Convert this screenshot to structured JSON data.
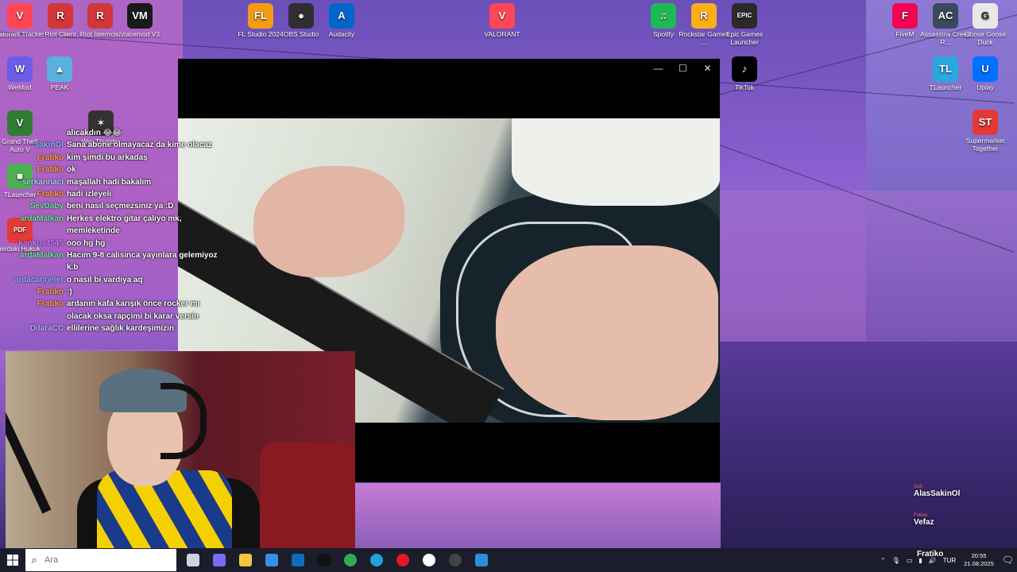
{
  "desktop": {
    "icons": [
      {
        "id": "valorant-tracker",
        "label": "Valorant Tracker",
        "color": "#ff4655",
        "glyph": "V"
      },
      {
        "id": "riot-client",
        "label": "Riot Client",
        "color": "#d13639",
        "glyph": "R"
      },
      {
        "id": "riot-istemcisi",
        "label": "Riot İstemcisi",
        "color": "#d13639",
        "glyph": "R"
      },
      {
        "id": "voicemod",
        "label": "Voicemod V3",
        "color": "#1a1a1a",
        "glyph": "VM"
      },
      {
        "id": "fl-studio",
        "label": "FL Studio 2024",
        "color": "#f39c12",
        "glyph": "FL"
      },
      {
        "id": "obs-studio",
        "label": "OBS Studio",
        "color": "#302e31",
        "glyph": "●"
      },
      {
        "id": "audacity",
        "label": "Audacity",
        "color": "#0066cc",
        "glyph": "A"
      },
      {
        "id": "valorant",
        "label": "VALORANT",
        "color": "#ff4655",
        "glyph": "V"
      },
      {
        "id": "spotify",
        "label": "Spotify",
        "color": "#1db954",
        "glyph": "♫"
      },
      {
        "id": "rockstar",
        "label": "Rockstar Games ...",
        "color": "#fcaf17",
        "glyph": "R"
      },
      {
        "id": "epic-games",
        "label": "Epic Games Launcher",
        "color": "#2a2a2a",
        "glyph": "EPIC"
      },
      {
        "id": "fivem",
        "label": "FiveM",
        "color": "#f40552",
        "glyph": "F"
      },
      {
        "id": "assassins-creed",
        "label": "Assassins Creed R...",
        "color": "#3a4a5a",
        "glyph": "AC"
      },
      {
        "id": "goose-goose-duck",
        "label": "Goose Goose Duck",
        "color": "#e8e8e8",
        "glyph": "G"
      },
      {
        "id": "wemod",
        "label": "WeMod",
        "color": "#6c5ce7",
        "glyph": "W"
      },
      {
        "id": "peak",
        "label": "PEAK",
        "color": "#5ab0e0",
        "glyph": "▲"
      },
      {
        "id": "tiktok",
        "label": "TikTok",
        "color": "#000000",
        "glyph": "♪"
      },
      {
        "id": "tlauncher",
        "label": "TLauncher",
        "color": "#29a8e0",
        "glyph": "TL"
      },
      {
        "id": "uplay",
        "label": "Uplay",
        "color": "#0070ff",
        "glyph": "U"
      },
      {
        "id": "gta5",
        "label": "Grand Theft Auto V",
        "color": "#2e7d32",
        "glyph": "V"
      },
      {
        "id": "war-thunder",
        "label": "War Thunder",
        "color": "#333333",
        "glyph": "✶"
      },
      {
        "id": "supermarket-together",
        "label": "Supermarket Together",
        "color": "#e53935",
        "glyph": "ST"
      },
      {
        "id": "minecraft-launcher",
        "label": "TLauncher",
        "color": "#4caf50",
        "glyph": "■"
      },
      {
        "id": "pdf-file",
        "label": "eirdaki Hukuk",
        "color": "#e53935",
        "glyph": "PDF"
      }
    ]
  },
  "video_window": {
    "minimize": "—",
    "maximize": "☐",
    "close": "✕"
  },
  "chat": {
    "messages": [
      {
        "user": "",
        "user_color": "#ffffff",
        "text": "alıcakdın 😂😂"
      },
      {
        "user": "SakinOl",
        "user_color": "#7fb3ff",
        "text": "Sana abone olmayacaz da kime olacaz"
      },
      {
        "user": "Fratiko",
        "user_color": "#ff9a3c",
        "text": "kim şimdi bu arkadaş"
      },
      {
        "user": "Fratiko",
        "user_color": "#ff9a3c",
        "text": "ok"
      },
      {
        "user": "serkannaci",
        "user_color": "#9ad1ff",
        "text": "maşallah hadi bakalım"
      },
      {
        "user": "Fratiko",
        "user_color": "#ff9a3c",
        "text": "hadi izleyeli"
      },
      {
        "user": "SevDaby",
        "user_color": "#6ee0a0",
        "text": "beni nasıl seçmezsiniz ya :D"
      },
      {
        "user": "ardaMalkan",
        "user_color": "#6ee0a0",
        "text": "Herkes elektro gitar çalıyo mk,"
      },
      {
        "user": "",
        "user_color": "#ffffff",
        "text": "memleketinde"
      },
      {
        "user": "kankus4545",
        "user_color": "#c77dff",
        "text": "ooo hg hg"
      },
      {
        "user": "ardaMalkan",
        "user_color": "#6ee0a0",
        "text": "Hacım 9-8 calisınca yayınlara gelemiyoz"
      },
      {
        "user": "",
        "user_color": "#ffffff",
        "text": "k.b"
      },
      {
        "user": "ardacangeler",
        "user_color": "#7fb3ff",
        "text": "o nasıl bi vardiya aq"
      },
      {
        "user": "Fratiko",
        "user_color": "#ff9a3c",
        "text": ":)"
      },
      {
        "user": "Fratiko",
        "user_color": "#ff9a3c",
        "text": "ardanın kafa karışık önce rocker mı"
      },
      {
        "user": "",
        "user_color": "#ffffff",
        "text": "olacak oksa rapçimi bi karar versin"
      },
      {
        "user": "DilaraCC",
        "user_color": "#b0b0ff",
        "text": "ellilerine sağlık kardeşimizin"
      }
    ]
  },
  "alerts": [
    {
      "tag": "Sub",
      "name": "AlasSakinOl"
    },
    {
      "tag": "Follow",
      "name": "Vefaz"
    },
    {
      "tag": "",
      "name": "Fratiko"
    }
  ],
  "taskbar": {
    "search_placeholder": "Ara",
    "apps": [
      {
        "id": "task-view",
        "color": "#cfd3e0"
      },
      {
        "id": "copilot",
        "color": "#7a6cf0"
      },
      {
        "id": "file-explorer",
        "color": "#f4c542"
      },
      {
        "id": "store",
        "color": "#3a8ee6"
      },
      {
        "id": "outlook",
        "color": "#0f6cbd"
      },
      {
        "id": "tiktok",
        "color": "#111111"
      },
      {
        "id": "chrome",
        "color": "#34a853"
      },
      {
        "id": "edge",
        "color": "#1fa3d8"
      },
      {
        "id": "opera",
        "color": "#e01a2b"
      },
      {
        "id": "yandex",
        "color": "#ffffff"
      },
      {
        "id": "obs",
        "color": "#444444"
      },
      {
        "id": "vscode",
        "color": "#2d8fd8"
      }
    ],
    "language": "TUR",
    "time": "20:55",
    "date": "21.08.2025"
  }
}
